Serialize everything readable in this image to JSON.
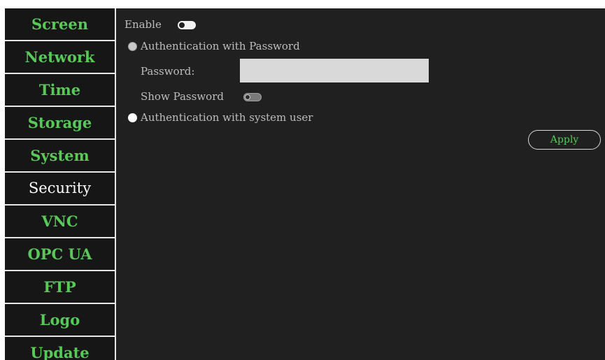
{
  "sidebar": {
    "items": [
      {
        "label": "Screen"
      },
      {
        "label": "Network"
      },
      {
        "label": "Time"
      },
      {
        "label": "Storage"
      },
      {
        "label": "System"
      },
      {
        "label": "Security"
      },
      {
        "label": "VNC"
      },
      {
        "label": "OPC UA"
      },
      {
        "label": "FTP"
      },
      {
        "label": "Logo"
      },
      {
        "label": "Update"
      }
    ],
    "active": "Security"
  },
  "security": {
    "enable_label": "Enable",
    "enable_state": "on",
    "auth_password_label": "Authentication with Password",
    "auth_password_selected": true,
    "password_label": "Password:",
    "password_value": "",
    "show_password_label": "Show Password",
    "show_password_state": "off",
    "auth_system_user_label": "Authentication with system user",
    "auth_system_user_selected": false,
    "apply_label": "Apply"
  },
  "colors": {
    "accent": "#58c858",
    "background": "#202020",
    "sidebar_background": "#161616",
    "text": "#bdbdbd"
  }
}
